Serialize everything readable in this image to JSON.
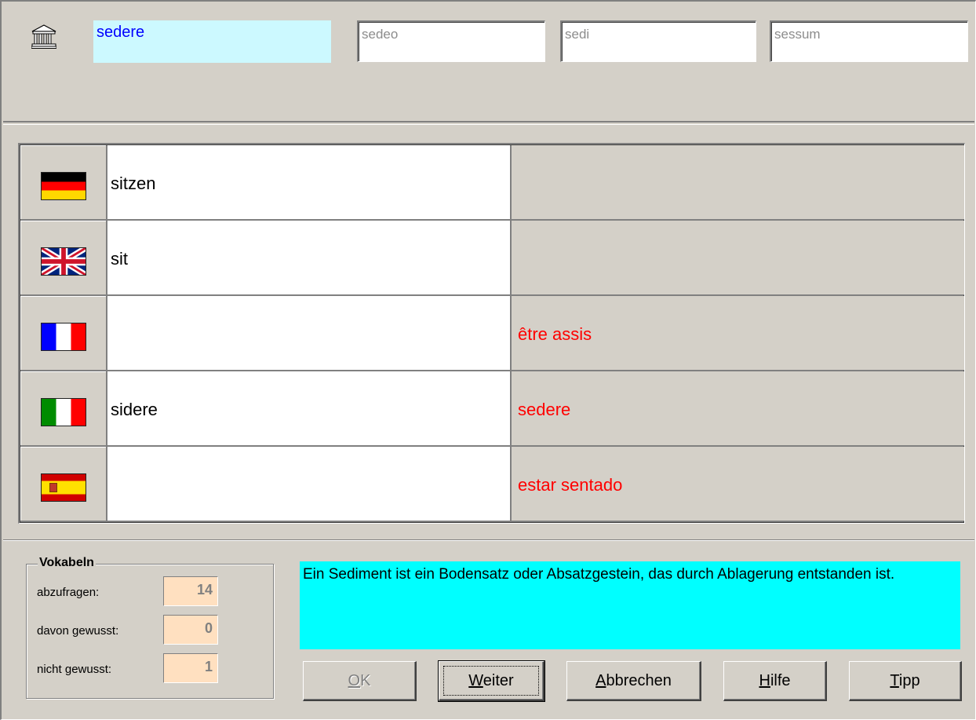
{
  "header": {
    "icon": "temple-icon",
    "word": "sedere",
    "stems": [
      "sedeo",
      "sedi",
      "sessum"
    ]
  },
  "rows": [
    {
      "flag": "germany-flag-icon",
      "answer": "sitzen",
      "solution": ""
    },
    {
      "flag": "uk-flag-icon",
      "answer": "sit",
      "solution": ""
    },
    {
      "flag": "france-flag-icon",
      "answer": "",
      "solution": "être assis"
    },
    {
      "flag": "italy-flag-icon",
      "answer": "sidere",
      "solution": "sedere"
    },
    {
      "flag": "spain-flag-icon",
      "answer": "",
      "solution": "estar sentado"
    }
  ],
  "vokabeln": {
    "title": "Vokabeln",
    "stats": [
      {
        "label": "abzufragen:",
        "value": "14"
      },
      {
        "label": "davon gewusst:",
        "value": "0"
      },
      {
        "label": "nicht gewusst:",
        "value": "1"
      }
    ]
  },
  "info": "Ein Sediment ist ein Bodensatz oder Absatzgestein, das durch Ablagerung entstanden ist.",
  "buttons": {
    "ok": {
      "mnemonic": "O",
      "rest": "K"
    },
    "weiter": {
      "mnemonic": "W",
      "rest": "eiter"
    },
    "abbrechen": {
      "mnemonic": "A",
      "rest": "bbrechen"
    },
    "hilfe": {
      "mnemonic": "H",
      "rest": "ilfe"
    },
    "tipp": {
      "mnemonic": "T",
      "rest": "ipp"
    }
  },
  "colors": {
    "window": "#d4d0c8",
    "word_bg": "#ccf9ff",
    "word_text": "#0000ff",
    "solution_text": "#ff0000",
    "info_bg": "#00ffff",
    "stat_bg": "#ffe0c0"
  }
}
